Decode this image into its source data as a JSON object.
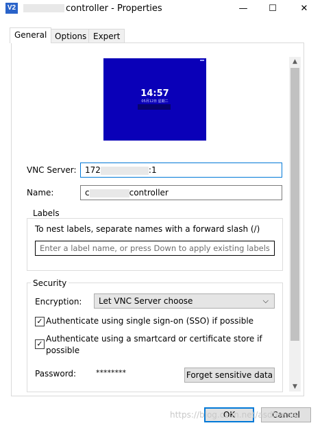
{
  "window": {
    "icon_text": "V2",
    "title": "controller - Properties",
    "minimize": "—",
    "maximize": "☐",
    "close": "✕"
  },
  "tabs": [
    {
      "label": "General"
    },
    {
      "label": "Options"
    },
    {
      "label": "Expert"
    }
  ],
  "preview": {
    "time": "14:57",
    "date": "05月12日 星期二"
  },
  "fields": {
    "vnc_server_label": "VNC Server:",
    "vnc_server_prefix": "172",
    "vnc_server_suffix": ":1",
    "name_label": "Name:",
    "name_prefix": "c",
    "name_suffix": "controller"
  },
  "labels_group": {
    "title": "Labels",
    "help": "To nest labels, separate names with a forward slash (/)",
    "placeholder": "Enter a label name, or press Down to apply existing labels"
  },
  "security": {
    "title": "Security",
    "encryption_label": "Encryption:",
    "encryption_value": "Let VNC Server choose",
    "sso_label": "Authenticate using single sign-on (SSO) if possible",
    "sso_checked": true,
    "smartcard_label_line1": "Authenticate using a smartcard or certificate store if",
    "smartcard_label_line2": "possible",
    "smartcard_checked": true,
    "password_label": "Password:",
    "password_value": "********",
    "forget_button": "Forget sensitive data"
  },
  "buttons": {
    "ok": "OK",
    "cancel": "Cancel"
  },
  "watermark": "https://blog.csdn.net/asdfewea"
}
